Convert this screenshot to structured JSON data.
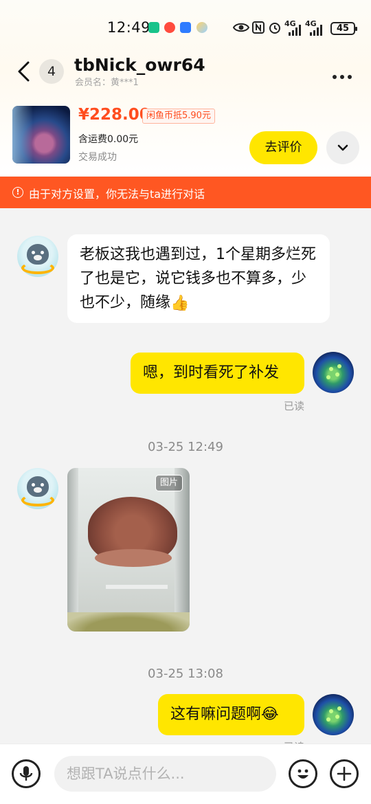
{
  "status_bar": {
    "time": "12:49",
    "network_1": "4G",
    "network_2": "4G",
    "battery": "45"
  },
  "header": {
    "unread_count": "4",
    "nickname": "tbNick_owr64",
    "member_label": "会员名：黄***1",
    "icons": [
      "back-arrow-icon",
      "more-dots-icon"
    ]
  },
  "product": {
    "price": "¥228.00",
    "coin_discount": "闲鱼币抵5.90元",
    "shipping": "含运费0.00元",
    "deal_status": "交易成功",
    "review_button": "去评价"
  },
  "notice": {
    "text": "由于对方设置，你无法与ta进行对话"
  },
  "messages": [
    {
      "side": "in",
      "type": "text",
      "text": "老板这我也遇到过，1个星期多烂死了也是它，说它钱多也不算多，少也不少，随缘",
      "emoji": "👍"
    },
    {
      "side": "out",
      "type": "text",
      "text": "嗯，到时看死了补发",
      "read_label": "已读"
    },
    {
      "type": "timestamp",
      "text": "03-25 12:49"
    },
    {
      "side": "in",
      "type": "image",
      "tag": "图片"
    },
    {
      "type": "timestamp",
      "text": "03-25 13:08"
    },
    {
      "side": "out",
      "type": "text",
      "text": "这有嘛问题啊",
      "emoji": "😂",
      "read_label": "已读"
    }
  ],
  "input_bar": {
    "placeholder": "想跟TA说点什么...",
    "icons": [
      "microphone-icon",
      "emoji-icon",
      "plus-icon"
    ]
  },
  "colors": {
    "accent_yellow": "#ffe600",
    "notice_orange": "#ff5722",
    "price_red": "#ff4d1f"
  }
}
